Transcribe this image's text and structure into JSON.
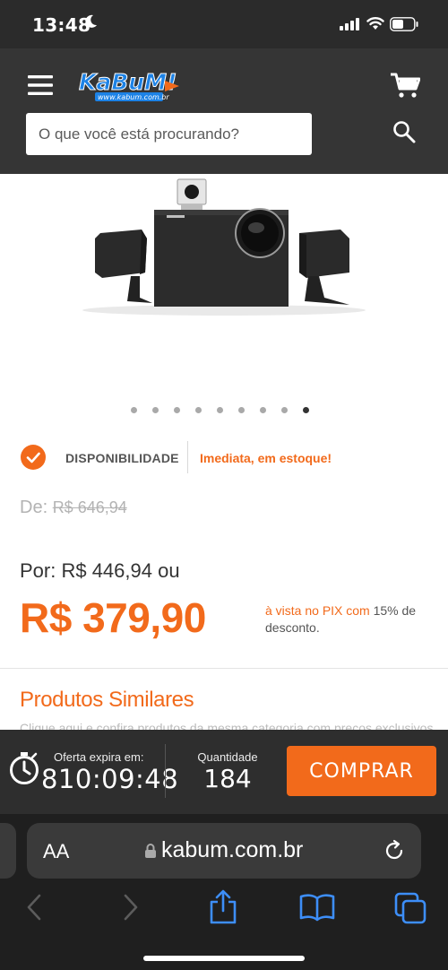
{
  "status_bar": {
    "time": "13:48",
    "icons": [
      "moon-icon",
      "signal-icon",
      "wifi-icon",
      "battery-icon"
    ]
  },
  "header": {
    "logo_text": "KaBuM!",
    "logo_url_text": "www.kabum.com.br",
    "search": {
      "placeholder": "O que você está procurando?"
    },
    "icons": [
      "menu-icon",
      "cart-icon",
      "search-icon"
    ]
  },
  "gallery": {
    "image_icon": "speaker-system-image",
    "dot_count": 9,
    "active_dot": 9
  },
  "availability": {
    "label": "DISPONIBILIDADE",
    "value": "Imediata, em estoque!"
  },
  "pricing": {
    "old_prefix": "De:",
    "old_price": "R$ 646,94",
    "por_line": "Por: R$ 446,94 ou",
    "pix_price": "R$ 379,90",
    "pix_highlight": "à vista no PIX com",
    "pix_rest": " 15% de desconto."
  },
  "similar": {
    "title": "Produtos Similares",
    "subtitle": "Clique aqui e confira produtos da mesma categoria com preços exclusivos"
  },
  "offer": {
    "timer_label": "Oferta expira em:",
    "timer_value": "810:09:48",
    "qty_label": "Quantidade",
    "qty_value": "184",
    "buy_label": "COMPRAR"
  },
  "browser": {
    "aa_label": "AA",
    "url": "kabum.com.br"
  },
  "colors": {
    "accent": "#f26a1b",
    "header_bg": "#353535",
    "offer_bg": "#2e2e2e"
  }
}
